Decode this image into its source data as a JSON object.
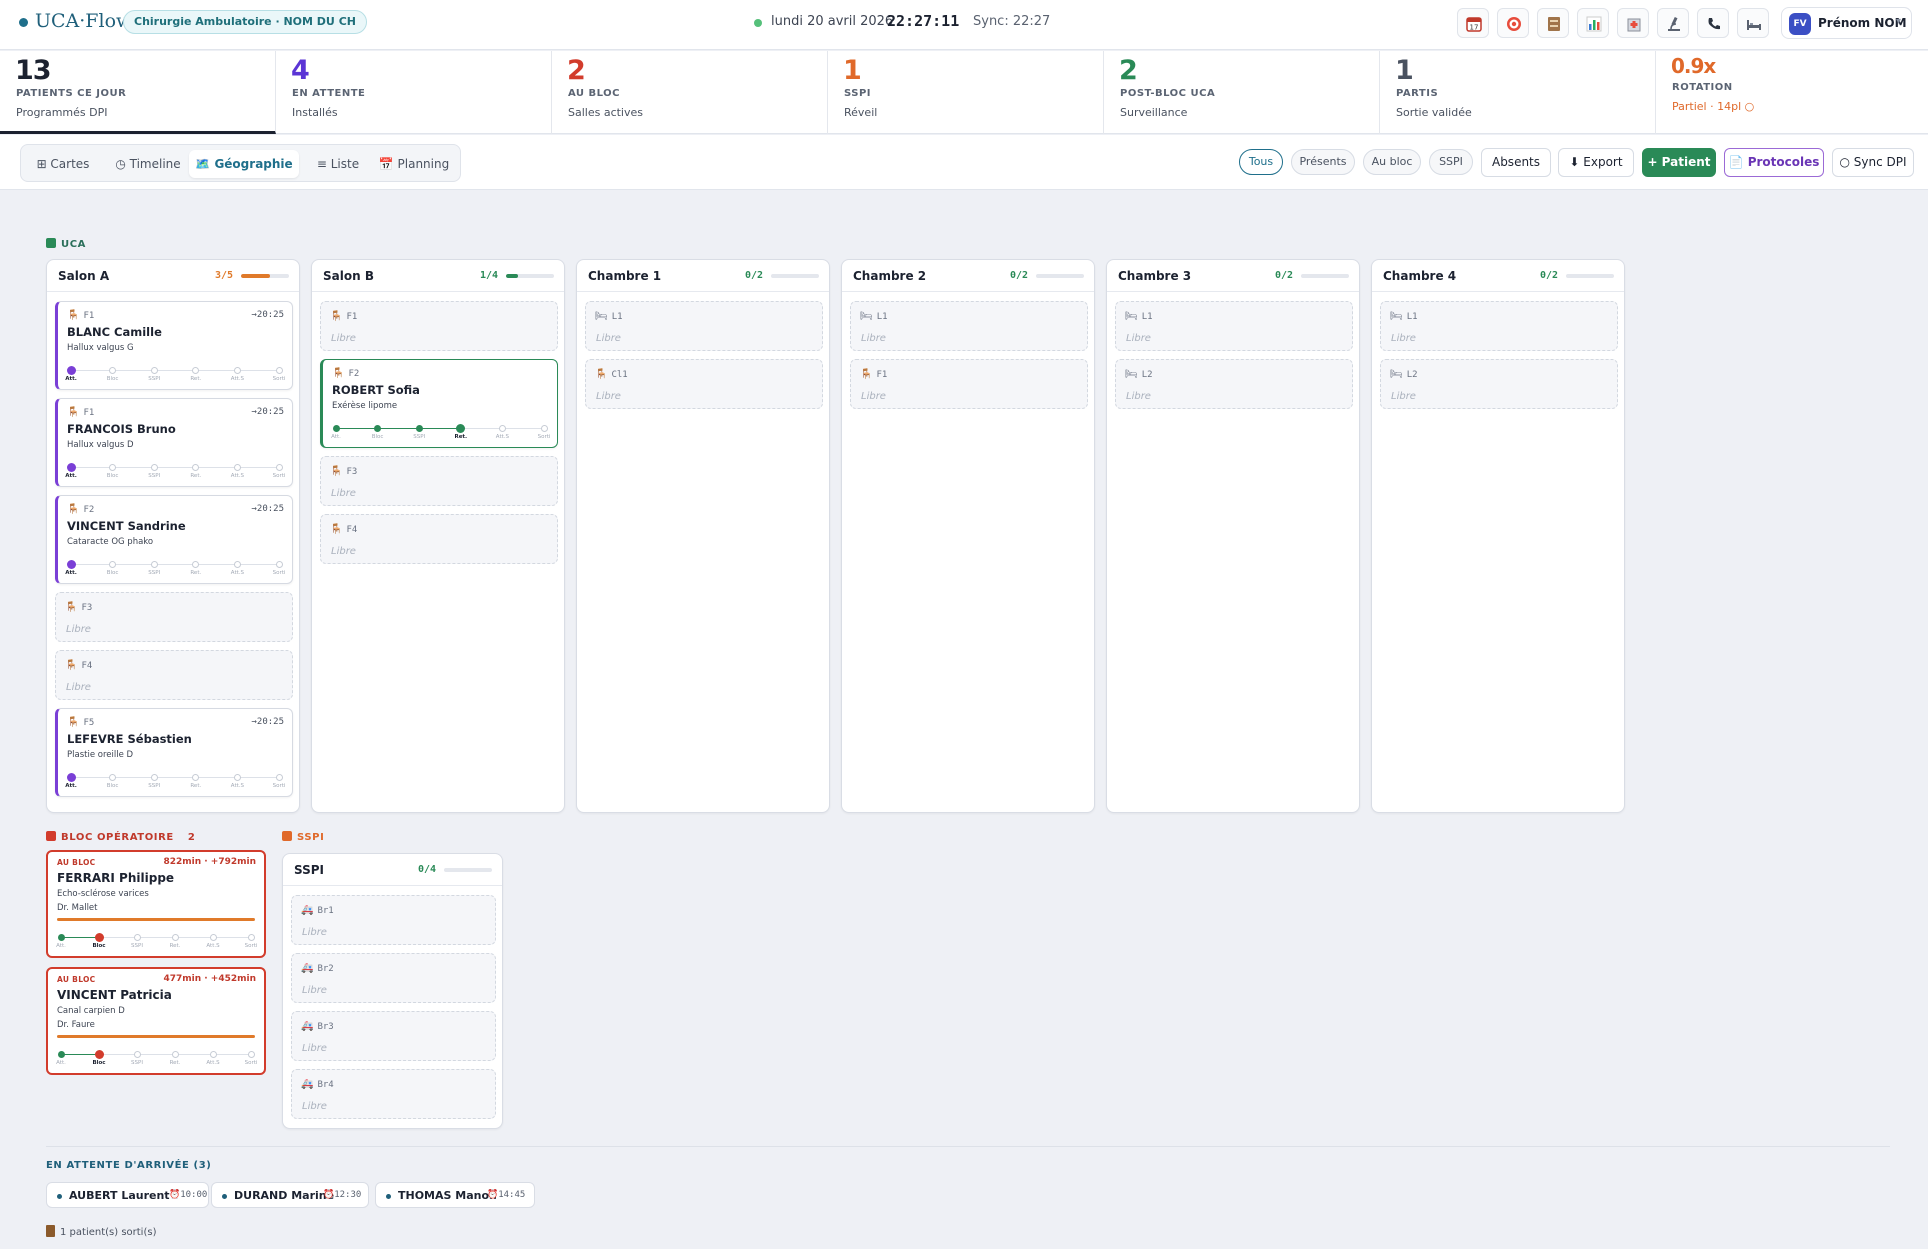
{
  "header": {
    "logo": "UCA·Flow",
    "service": "Chirurgie Ambulatoire · NOM DU CH",
    "date": "lundi 20 avril 2026",
    "clock": "22:27:11",
    "sync": "Sync: 22:27",
    "user_initials": "FV",
    "user_name": "Prénom NOM",
    "tools": [
      "calendar-icon",
      "target-icon",
      "archive-icon",
      "bar-chart-icon",
      "hospital-icon",
      "microscope-icon",
      "phone-icon",
      "bed-icon"
    ]
  },
  "stats": [
    {
      "num": "13",
      "label": "PATIENTS CE JOUR",
      "sub": "Programmés DPI",
      "color": "#1c2230"
    },
    {
      "num": "4",
      "label": "EN ATTENTE",
      "sub": "Installés",
      "color": "#5b35d5"
    },
    {
      "num": "2",
      "label": "AU BLOC",
      "sub": "Salles actives",
      "color": "#d23c2c"
    },
    {
      "num": "1",
      "label": "SSPI",
      "sub": "Réveil",
      "color": "#e0692a"
    },
    {
      "num": "2",
      "label": "POST-BLOC UCA",
      "sub": "Surveillance",
      "color": "#2a8a57"
    },
    {
      "num": "1",
      "label": "PARTIS",
      "sub": "Sortie validée",
      "color": "#4a5260"
    },
    {
      "num": "0.9x",
      "label": "ROTATION",
      "sub": "Partiel · 14pl ○",
      "color": "#e0692a"
    }
  ],
  "views": [
    {
      "label": "⊞ Cartes"
    },
    {
      "label": "◷ Timeline"
    },
    {
      "label": "🗺️ Géographie"
    },
    {
      "label": "≡ Liste"
    },
    {
      "label": "📅 Planning"
    }
  ],
  "filters": [
    "Tous",
    "Présents",
    "Au bloc",
    "SSPI",
    "Absents"
  ],
  "actions": {
    "export": "⬇ Export",
    "patient": "+ Patient",
    "protocoles": "📄 Protocoles",
    "sync": "○ Sync DPI"
  },
  "steps": [
    "Att.",
    "Bloc",
    "SSPI",
    "Ret.",
    "Att.S",
    "Sorti"
  ],
  "colors": {
    "purple": "#7a3fd6",
    "green": "#2a8a57",
    "red": "#d23c2c",
    "orange": "#e07a2a"
  },
  "sections": {
    "uca": "UCA",
    "bloc": "BLOC OPÉRATOIRE",
    "bloc_count": "2",
    "sspi": "SSPI"
  },
  "rooms": [
    {
      "name": "Salon A",
      "occ": "3/5",
      "fill": 0.6,
      "slots": [
        {
          "code": "F1",
          "name": "BLANC Camille",
          "proc": "Hallux valgus G",
          "time": "→20:25",
          "step": 0,
          "color": "#7a3fd6"
        },
        {
          "code": "F1",
          "name": "FRANCOIS Bruno",
          "proc": "Hallux valgus D",
          "time": "→20:25",
          "step": 0,
          "color": "#7a3fd6"
        },
        {
          "code": "F2",
          "name": "VINCENT Sandrine",
          "proc": "Cataracte OG phako",
          "time": "→20:25",
          "step": 0,
          "color": "#7a3fd6"
        },
        {
          "code": "F3",
          "free": "Libre"
        },
        {
          "code": "F4",
          "free": "Libre"
        },
        {
          "code": "F5",
          "name": "LEFEVRE Sébastien",
          "proc": "Plastie oreille D",
          "time": "→20:25",
          "step": 0,
          "color": "#7a3fd6"
        }
      ]
    },
    {
      "name": "Salon B",
      "occ": "1/4",
      "fill": 0.25,
      "slots": [
        {
          "code": "F1",
          "free": "Libre"
        },
        {
          "code": "F2",
          "name": "ROBERT Sofia",
          "proc": "Exérèse lipome",
          "time": "",
          "step": 3,
          "color": "#2a8a57"
        },
        {
          "code": "F3",
          "free": "Libre"
        },
        {
          "code": "F4",
          "free": "Libre"
        }
      ]
    },
    {
      "name": "Chambre 1",
      "occ": "0/2",
      "fill": 0,
      "slots": [
        {
          "code": "L1",
          "free": "Libre",
          "icon": "bed"
        },
        {
          "code": "Cl1",
          "free": "Libre",
          "icon": "chair"
        }
      ]
    },
    {
      "name": "Chambre 2",
      "occ": "0/2",
      "fill": 0,
      "slots": [
        {
          "code": "L1",
          "free": "Libre",
          "icon": "bed"
        },
        {
          "code": "F1",
          "free": "Libre"
        }
      ]
    },
    {
      "name": "Chambre 3",
      "occ": "0/2",
      "fill": 0,
      "slots": [
        {
          "code": "L1",
          "free": "Libre",
          "icon": "bed"
        },
        {
          "code": "L2",
          "free": "Libre",
          "icon": "bed"
        }
      ]
    },
    {
      "name": "Chambre 4",
      "occ": "0/2",
      "fill": 0,
      "slots": [
        {
          "code": "L1",
          "free": "Libre",
          "icon": "bed"
        },
        {
          "code": "L2",
          "free": "Libre",
          "icon": "bed"
        }
      ]
    }
  ],
  "bloc": [
    {
      "status": "AU BLOC",
      "time": "822min · +792min",
      "name": "FERRARI Philippe",
      "proc": "Echo-sclérose varices",
      "doctor": "Dr. Mallet",
      "step": 1
    },
    {
      "status": "AU BLOC",
      "time": "477min · +452min",
      "name": "VINCENT Patricia",
      "proc": "Canal carpien D",
      "doctor": "Dr. Faure",
      "step": 1
    }
  ],
  "sspi": {
    "name": "SSPI",
    "occ": "0/4",
    "fill": 0,
    "slots": [
      {
        "code": "Br1",
        "free": "Libre"
      },
      {
        "code": "Br2",
        "free": "Libre"
      },
      {
        "code": "Br3",
        "free": "Libre"
      },
      {
        "code": "Br4",
        "free": "Libre"
      }
    ]
  },
  "waiting": {
    "title": "EN ATTENTE D'ARRIVÉE (3)",
    "items": [
      {
        "name": "AUBERT Laurent",
        "time": "⏰10:00"
      },
      {
        "name": "DURAND Marine",
        "time": "⏰12:30"
      },
      {
        "name": "THOMAS Manon",
        "time": "⏰14:45"
      }
    ]
  },
  "left": {
    "text": "1 patient(s) sorti(s)"
  }
}
